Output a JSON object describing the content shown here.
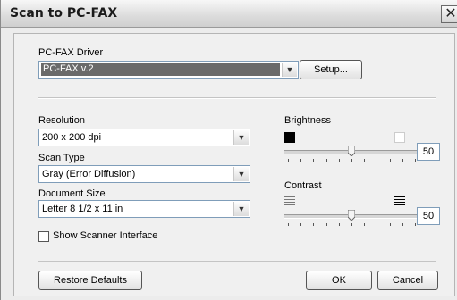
{
  "window": {
    "title": "Scan to PC-FAX",
    "close_symbol": "✕"
  },
  "driver": {
    "label": "PC-FAX Driver",
    "value": "PC-FAX v.2",
    "setup_label": "Setup..."
  },
  "resolution": {
    "label": "Resolution",
    "value": "200 x 200 dpi"
  },
  "scan_type": {
    "label": "Scan Type",
    "value": "Gray (Error Diffusion)"
  },
  "document_size": {
    "label": "Document Size",
    "value": "Letter 8 1/2 x 11 in"
  },
  "show_scanner_interface": {
    "label": "Show Scanner Interface",
    "checked": false
  },
  "brightness": {
    "label": "Brightness",
    "value": "50",
    "level": 0.5
  },
  "contrast": {
    "label": "Contrast",
    "value": "50",
    "level": 0.5
  },
  "buttons": {
    "restore_defaults": "Restore Defaults",
    "ok": "OK",
    "cancel": "Cancel"
  },
  "icons": {
    "dropdown_arrow": "chevron-down-icon"
  }
}
